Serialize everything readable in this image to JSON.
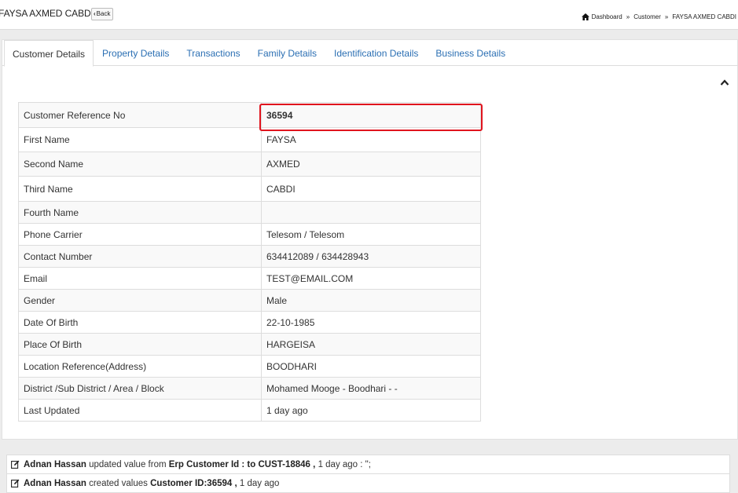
{
  "header": {
    "title": "FAYSA AXMED CABDI",
    "back_label": "Back",
    "breadcrumb": [
      "Dashboard",
      "Customer",
      "FAYSA AXMED CABDI"
    ]
  },
  "tabs": [
    {
      "label": "Customer Details",
      "active": true
    },
    {
      "label": "Property Details",
      "active": false
    },
    {
      "label": "Transactions",
      "active": false
    },
    {
      "label": "Family Details",
      "active": false
    },
    {
      "label": "Identification Details",
      "active": false
    },
    {
      "label": "Business Details",
      "active": false
    }
  ],
  "details": [
    {
      "label": "Customer Reference No",
      "value": "36594"
    },
    {
      "label": "First Name",
      "value": "FAYSA"
    },
    {
      "label": "Second Name",
      "value": "AXMED"
    },
    {
      "label": "Third Name",
      "value": "CABDI"
    },
    {
      "label": "Fourth Name",
      "value": ""
    },
    {
      "label": "Phone Carrier",
      "value": "Telesom / Telesom"
    },
    {
      "label": "Contact Number",
      "value": "634412089 / 634428943"
    },
    {
      "label": "Email",
      "value": "TEST@EMAIL.COM"
    },
    {
      "label": "Gender",
      "value": "Male"
    },
    {
      "label": "Date Of Birth",
      "value": "22-10-1985"
    },
    {
      "label": "Place Of Birth",
      "value": "HARGEISA"
    },
    {
      "label": "Location Reference(Address)",
      "value": "BOODHARI"
    },
    {
      "label": "District /Sub District / Area / Block",
      "value": "Mohamed Mooge - Boodhari - -"
    },
    {
      "label": "Last Updated",
      "value": "1 day ago"
    }
  ],
  "activity": [
    {
      "user": "Adnan Hassan",
      "action": "updated value from",
      "detail": "Erp Customer Id : to CUST-18846 ,",
      "time": "1 day ago : \";"
    },
    {
      "user": "Adnan Hassan",
      "action": "created values",
      "detail": "Customer ID:36594 ,",
      "time": "1 day ago"
    }
  ],
  "colors": {
    "link": "#2b6fb3",
    "highlight": "#e0141e"
  }
}
